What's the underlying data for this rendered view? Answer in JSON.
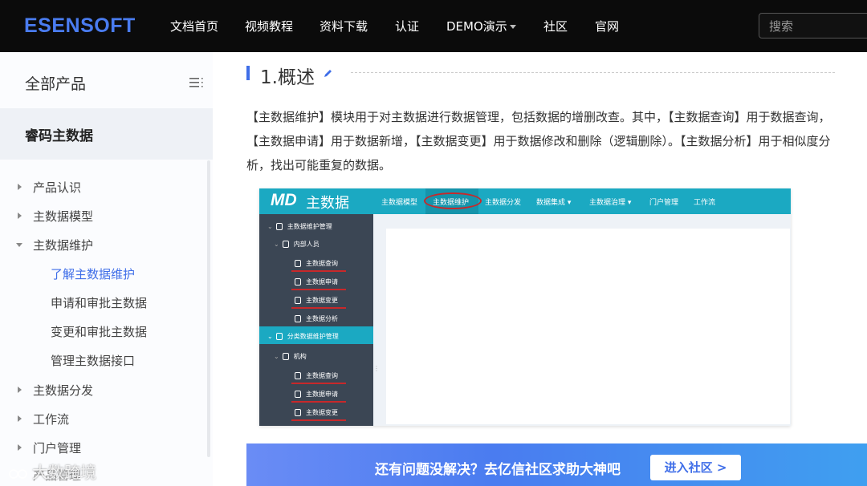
{
  "header": {
    "logo": "ESENSOFT",
    "nav": [
      "文档首页",
      "视频教程",
      "资料下载",
      "认证",
      "DEMO演示",
      "社区",
      "官网"
    ],
    "search_placeholder": "搜索"
  },
  "sidebar": {
    "title": "全部产品",
    "product": "睿码主数据",
    "items": [
      {
        "label": "产品认识",
        "expanded": false
      },
      {
        "label": "主数据模型",
        "expanded": false
      },
      {
        "label": "主数据维护",
        "expanded": true
      },
      {
        "label": "了解主数据维护",
        "active": true
      },
      {
        "label": "申请和审批主数据"
      },
      {
        "label": "变更和审批主数据"
      },
      {
        "label": "管理主数据接口"
      },
      {
        "label": "主数据分发",
        "expanded": false
      },
      {
        "label": "工作流",
        "expanded": false
      },
      {
        "label": "门户管理",
        "expanded": false
      },
      {
        "label": "产品管理"
      }
    ]
  },
  "content": {
    "heading": "1.概述",
    "paragraph": "【主数据维护】模块用于对主数据进行数据管理，包括数据的增删改查。其中，【主数据查询】用于数据查询，【主数据申请】用于数据新增，【主数据变更】用于数据修改和删除（逻辑删除）。【主数据分析】用于相似度分析，找出可能重复的数据。",
    "screenshot": {
      "logo_mark": "MD",
      "logo_text": "主数据",
      "nav": [
        "主数据模型",
        "主数据维护",
        "主数据分发",
        "数据集成 ▾",
        "主数据治理 ▾",
        "门户管理",
        "工作流"
      ],
      "tree": [
        "主数据维护管理",
        "内部人员",
        "主数据查询",
        "主数据申请",
        "主数据变更",
        "主数据分析",
        "分类数据维护管理",
        "机构",
        "主数据查询",
        "主数据申请",
        "主数据变更"
      ]
    },
    "banner_text": "还有问题没解决？去亿信社区求助大神吧",
    "banner_button": "进入社区 >"
  },
  "watermark": "大数跨境",
  "colors": {
    "accent": "#3f6ee8",
    "screenshot_teal": "#1ba9c2",
    "screenshot_side": "#3b4654",
    "annotation_red": "#c8282a"
  }
}
